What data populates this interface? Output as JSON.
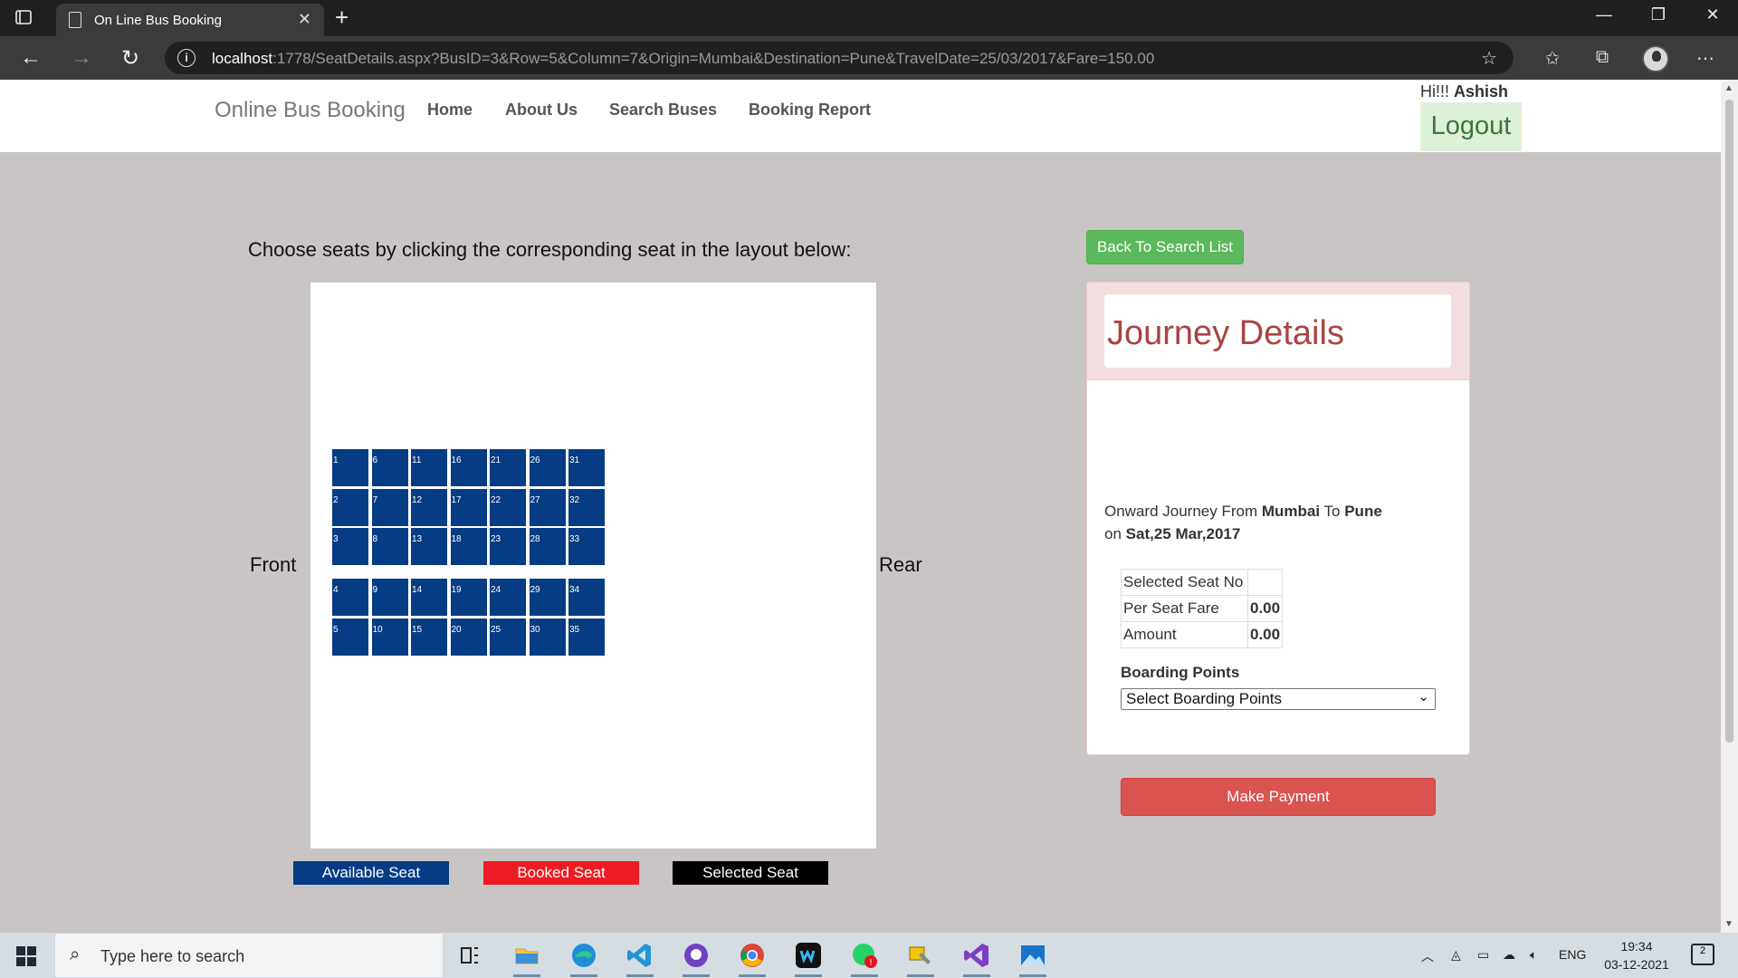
{
  "browser": {
    "tab_title": "On Line Bus Booking",
    "url_host": "localhost",
    "url_rest": ":1778/SeatDetails.aspx?BusID=3&Row=5&Column=7&Origin=Mumbai&Destination=Pune&TravelDate=25/03/2017&Fare=150.00"
  },
  "nav": {
    "brand": "Online Bus Booking",
    "links": [
      "Home",
      "About Us",
      "Search Buses",
      "Booking Report"
    ],
    "greeting": "Hi!!!",
    "user": "Ashish",
    "logout": "Logout"
  },
  "seating": {
    "instruction": "Choose seats by clicking the corresponding seat in the layout below:",
    "front_label": "Front",
    "rear_label": "Rear",
    "seat_color": "#063c84",
    "seats_top_block": [
      [
        "1",
        "6",
        "11",
        "16",
        "21",
        "26",
        "31"
      ],
      [
        "2",
        "7",
        "12",
        "17",
        "22",
        "27",
        "32"
      ],
      [
        "3",
        "8",
        "13",
        "18",
        "23",
        "28",
        "33"
      ]
    ],
    "seats_bottom_block": [
      [
        "4",
        "9",
        "14",
        "19",
        "24",
        "29",
        "34"
      ],
      [
        "5",
        "10",
        "15",
        "20",
        "25",
        "30",
        "35"
      ]
    ]
  },
  "legend": {
    "available": "Available Seat",
    "booked": "Booked Seat",
    "selected": "Selected Seat",
    "available_color": "#063c84",
    "booked_color": "#ed1c24",
    "selected_color": "#000000"
  },
  "journey": {
    "back_button": "Back To Search List",
    "title": "Journey Details",
    "onward_prefix": "Onward Journey From",
    "origin": "Mumbai",
    "to_word": "To",
    "destination": "Pune",
    "on_word": "on",
    "date": "Sat,25 Mar,2017",
    "fare_rows": [
      {
        "label": "Selected Seat No",
        "value": ""
      },
      {
        "label": "Per Seat Fare",
        "value": "0.00"
      },
      {
        "label": "Amount",
        "value": "0.00"
      }
    ],
    "boarding_label": "Boarding Points",
    "boarding_selected": "Select Boarding Points",
    "pay_button": "Make Payment"
  },
  "taskbar": {
    "search_placeholder": "Type here to search",
    "language": "ENG",
    "time": "19:34",
    "date": "03-12-2021",
    "notification_count": "2"
  }
}
